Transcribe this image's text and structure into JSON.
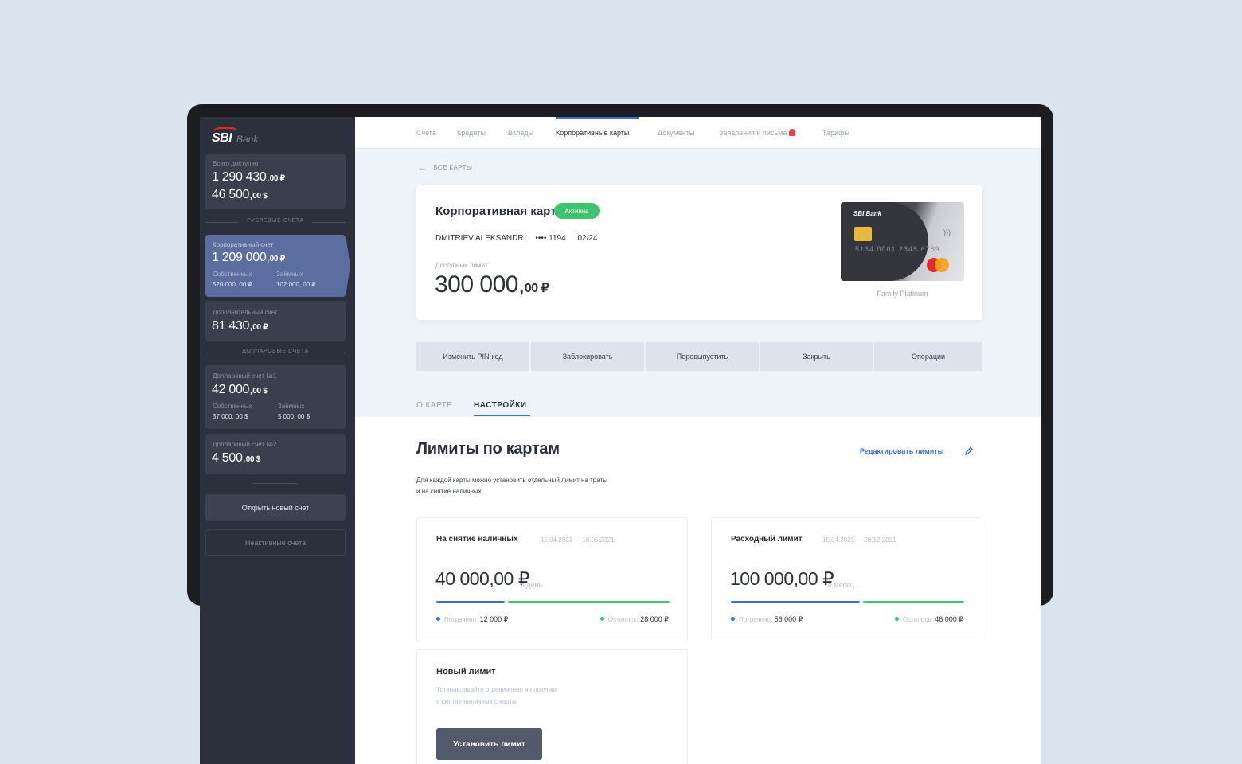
{
  "brand": {
    "name": "SBI",
    "sub": "Bank",
    "accent": "#d8272d"
  },
  "sidebar": {
    "total": {
      "label": "Всего доступно",
      "rub_main": "1 290 430,",
      "rub_cents": "00 ₽",
      "usd_main": "46 500,",
      "usd_cents": "00 $"
    },
    "section_rub": "РУБЛЕВЫЕ СЧЕТА",
    "corp": {
      "label": "Корпоративный счет",
      "main": "1 209 000,",
      "cents": "00 ₽",
      "own_label": "Собственных",
      "own_value": "520 000, 00 ₽",
      "borrowed_label": "Заёмных",
      "borrowed_value": "102 000, 00 ₽"
    },
    "extra": {
      "label": "Дополнительный счет",
      "main": "81 430,",
      "cents": "00 ₽"
    },
    "section_usd": "ДОЛЛАРОВЫЕ СЧЕТА",
    "usd1": {
      "label": "Долларовый счет №1",
      "main": "42 000,",
      "cents": "00 $",
      "own_label": "Собственных",
      "own_value": "37 000, 00 $",
      "borrowed_label": "Заёмных",
      "borrowed_value": "5 000, 00 $"
    },
    "usd2": {
      "label": "Долларовый счет №2",
      "main": "4 500,",
      "cents": "00 $"
    },
    "open_btn": "Открыть новый счет",
    "inactive_btn": "Неактивные счета"
  },
  "nav": {
    "items": [
      "Счета",
      "Кредиты",
      "Вклады",
      "Корпоративные карты",
      "Документы",
      "Заявления и письма",
      "Тарифы"
    ],
    "active_index": 3
  },
  "back": "ВСЕ КАРТЫ",
  "card": {
    "title": "Корпоративная карта",
    "status": "Активна",
    "holder": "DMITRIEV ALEKSANDR",
    "masked": "•••• 1194",
    "expiry": "02/24",
    "limit_label": "Доступный лимит",
    "limit_main": "300 000,",
    "limit_cents": "00 ₽",
    "image_brand": "SBI Bank",
    "image_number": "5134 0001 2345 6789",
    "caption": "Family Platinum"
  },
  "actions": [
    "Изменить PIN-код",
    "Заблокировать",
    "Перевыпустить",
    "Закрыть",
    "Операции"
  ],
  "tabs": [
    "О КАРТЕ",
    "НАСТРОЙКИ"
  ],
  "limits": {
    "title": "Лимиты по картам",
    "edit": "Редактировать лимиты",
    "desc_line1": "Для каждой карты можно установить отдельный лимит на траты",
    "desc_line2": "и на снятие наличных",
    "cash": {
      "title": "На снятие наличных",
      "dates": "15.04.2021 — 16.05.2021",
      "amount": "40 000,00 ₽",
      "period": "в день",
      "spent_label": "Потрачено:",
      "spent": "12 000 ₽",
      "left_label": "Осталось:",
      "left": "28 000 ₽",
      "spent_fraction": 0.3
    },
    "spend": {
      "title": "Расходный лимит",
      "dates": "15.04.2021 — 28.12.2021",
      "amount": "100 000,00 ₽",
      "period": "в месяц",
      "spent_label": "Потрачено:",
      "spent": "56 000 ₽",
      "left_label": "Осталось:",
      "left": "46 000 ₽",
      "spent_fraction": 0.56
    }
  },
  "new_limit": {
    "title": "Новый лимит",
    "desc_line1": "Устанавливайте ограничения на покупки",
    "desc_line2": "и снятие наличных с карты",
    "button": "Установить лимит"
  },
  "colors": {
    "accent_blue": "#3b6fd8",
    "green": "#3ec36f",
    "sidebar": "#2c303c"
  }
}
